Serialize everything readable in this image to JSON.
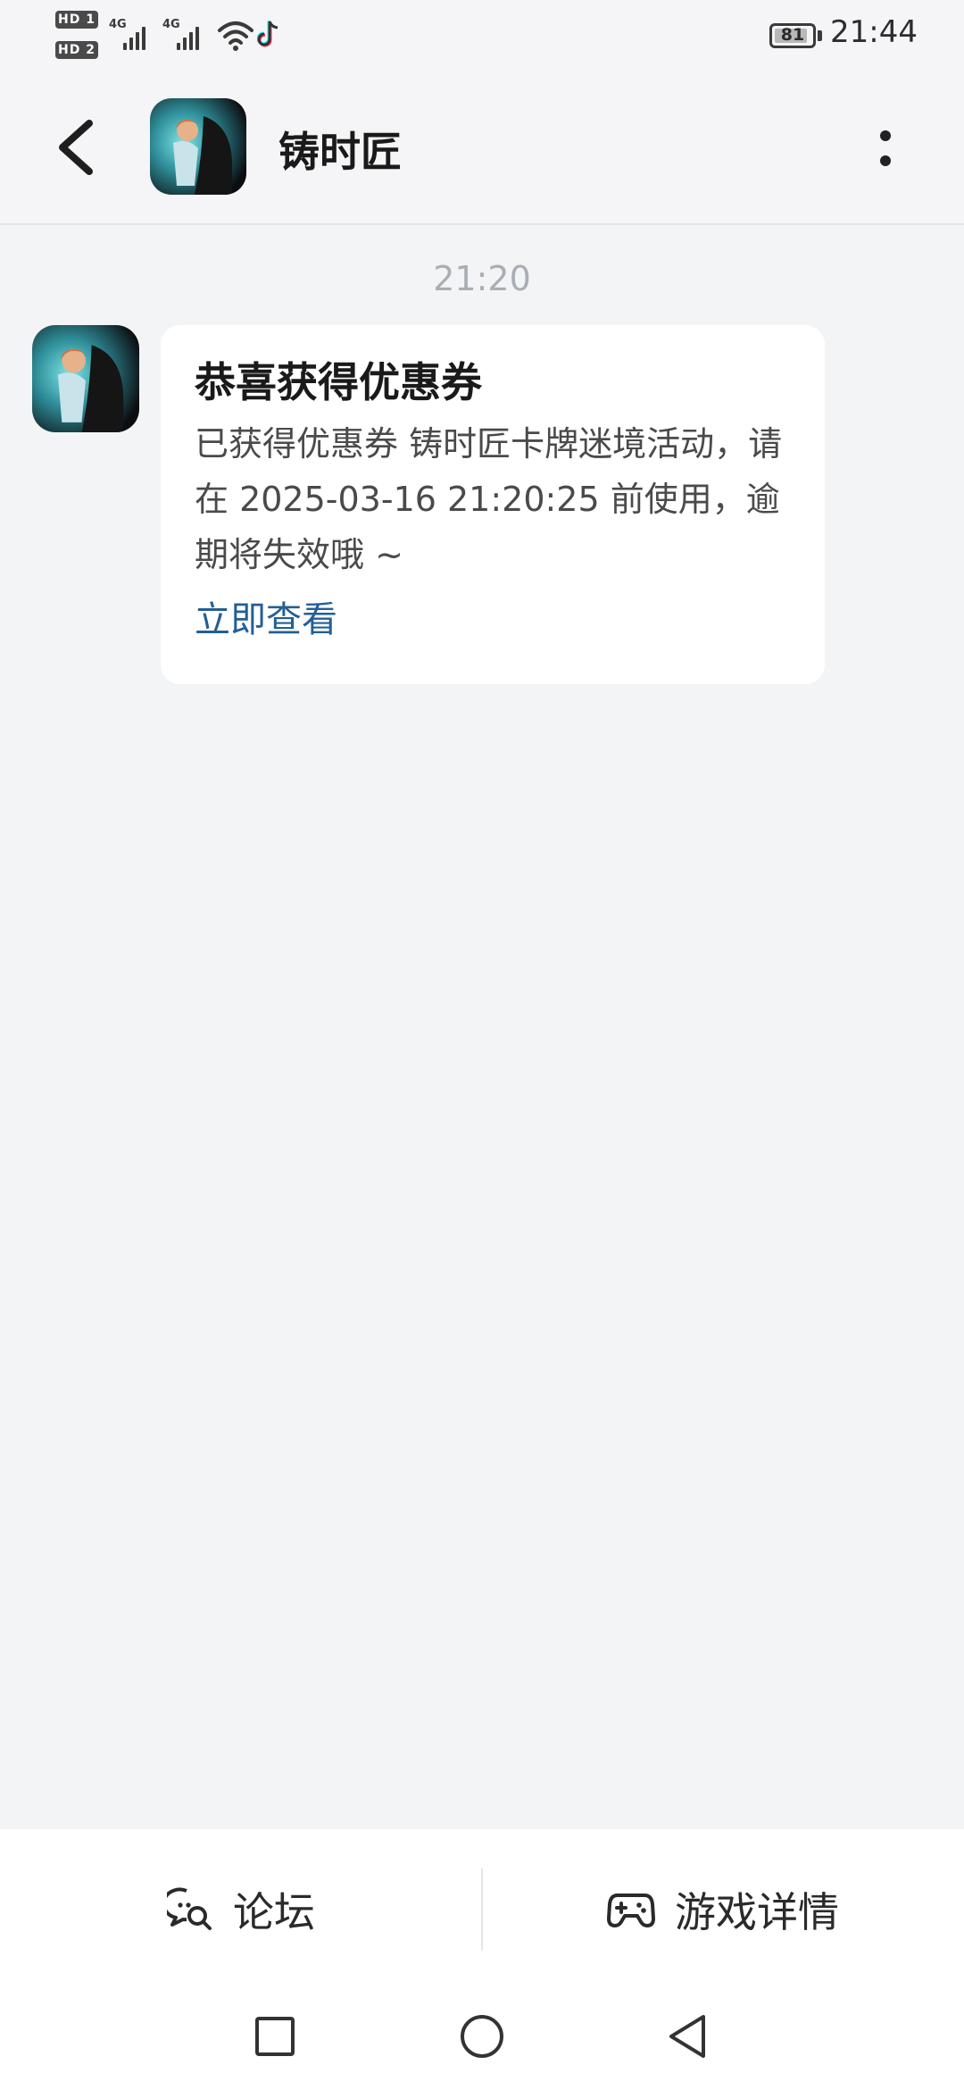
{
  "status_bar": {
    "hd1": "HD 1",
    "hd2": "HD 2",
    "network1": "4G",
    "network2": "4G",
    "battery_percent": "81",
    "battery_level": 81,
    "time": "21:44"
  },
  "header": {
    "title": "铸时匠",
    "back_icon": "chevron-left-icon",
    "more_icon": "more-vertical-icon"
  },
  "chat": {
    "timestamp": "21:20",
    "message": {
      "title": "恭喜获得优惠券",
      "body": "已获得优惠券 铸时匠卡牌迷境活动，请在 2025-03-16 21:20:25 前使用，逾期将失效哦 ~",
      "link": "立即查看"
    }
  },
  "actions": {
    "forum": {
      "label": "论坛",
      "icon": "forum-chat-icon"
    },
    "game_details": {
      "label": "游戏详情",
      "icon": "gamepad-icon"
    }
  },
  "colors": {
    "background": "#f3f4f6",
    "link": "#235f95",
    "timestamp": "#a9aeb5"
  }
}
